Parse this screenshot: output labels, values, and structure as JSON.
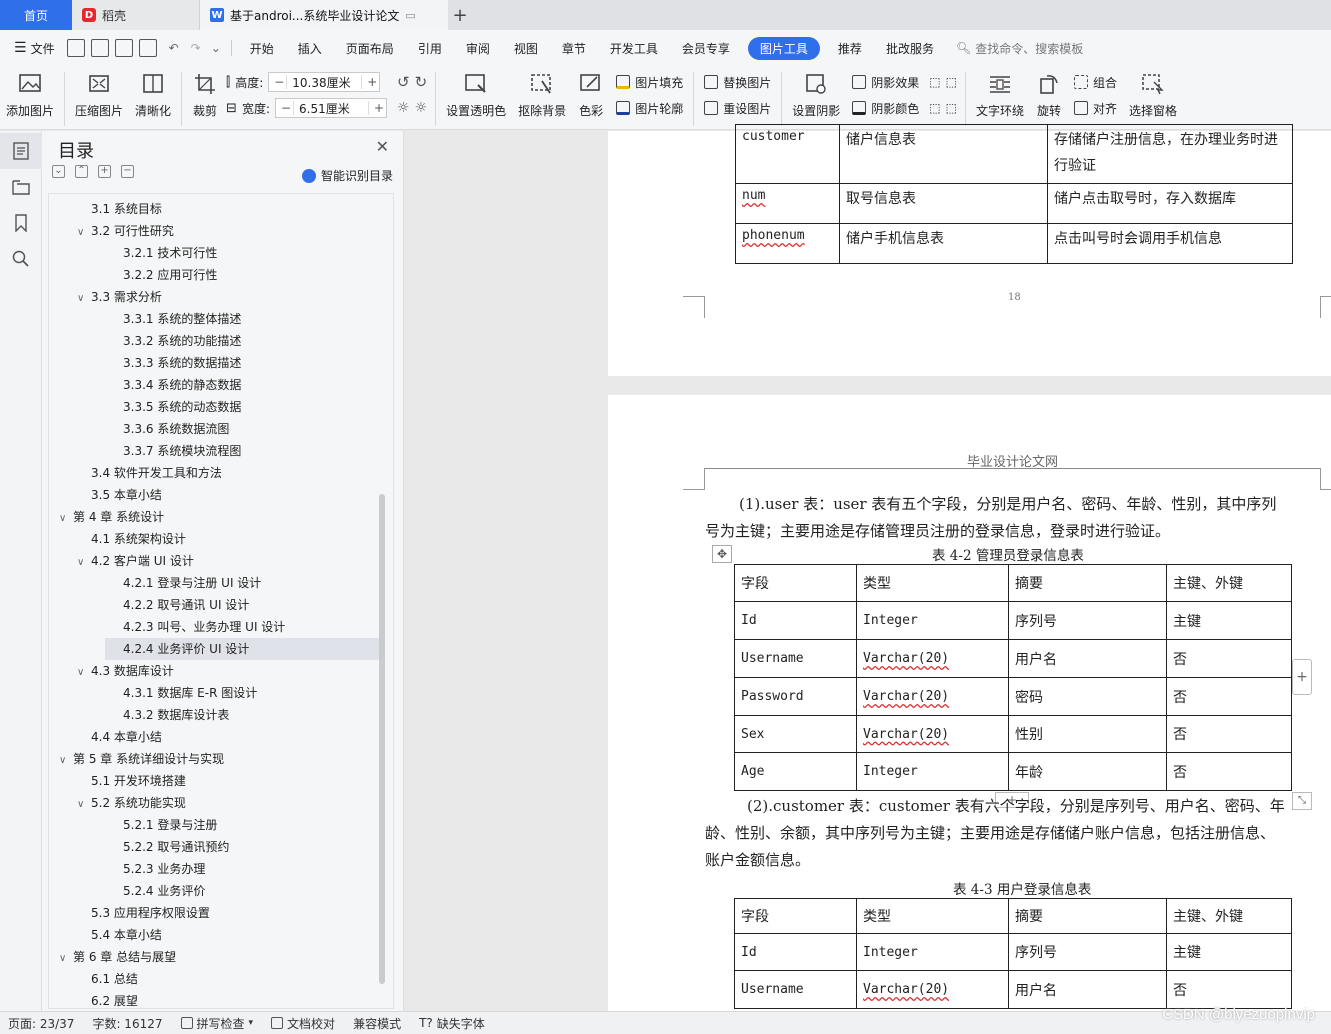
{
  "tabs": {
    "home": "首页",
    "t2": "稻壳",
    "t3": "基于androi...系统毕业设计论文"
  },
  "menu": {
    "file": "文件",
    "items": [
      "开始",
      "插入",
      "页面布局",
      "引用",
      "审阅",
      "视图",
      "章节",
      "开发工具",
      "会员专享",
      "图片工具",
      "推荐",
      "批改服务"
    ],
    "search": "查找命令、搜索模板"
  },
  "ribbon": {
    "add_image": "添加图片",
    "compress": "压缩图片",
    "sharpen": "清晰化",
    "crop": "裁剪",
    "height_label": "高度:",
    "height_value": "10.38厘米",
    "width_label": "宽度:",
    "width_value": "6.51厘米",
    "transparent": "设置透明色",
    "remove_bg": "抠除背景",
    "color": "色彩",
    "fill": "图片填充",
    "outline": "图片轮廓",
    "replace": "替换图片",
    "reset": "重设图片",
    "set_shadow": "设置阴影",
    "shadow_effect": "阴影效果",
    "shadow_color": "阴影颜色",
    "wrap": "文字环绕",
    "rotate": "旋转",
    "group": "组合",
    "align": "对齐",
    "selection_pane": "选择窗格"
  },
  "toc": {
    "title": "目录",
    "smart": "智能识别目录",
    "items": [
      {
        "label": "3.1  系统目标",
        "level": 2,
        "chev": ""
      },
      {
        "label": "3.2  可行性研究",
        "level": 2,
        "chev": "v"
      },
      {
        "label": "3.2.1  技术可行性",
        "level": 3,
        "chev": ""
      },
      {
        "label": "3.2.2  应用可行性",
        "level": 3,
        "chev": ""
      },
      {
        "label": "3.3  需求分析",
        "level": 2,
        "chev": "v"
      },
      {
        "label": "3.3.1  系统的整体描述",
        "level": 3,
        "chev": ""
      },
      {
        "label": "3.3.2  系统的功能描述",
        "level": 3,
        "chev": ""
      },
      {
        "label": "3.3.3 系统的数据描述",
        "level": 3,
        "chev": ""
      },
      {
        "label": "3.3.4  系统的静态数据",
        "level": 3,
        "chev": ""
      },
      {
        "label": "3.3.5  系统的动态数据",
        "level": 3,
        "chev": ""
      },
      {
        "label": "3.3.6  系统数据流图",
        "level": 3,
        "chev": ""
      },
      {
        "label": "3.3.7  系统模块流程图",
        "level": 3,
        "chev": ""
      },
      {
        "label": "3.4  软件开发工具和方法",
        "level": 2,
        "chev": ""
      },
      {
        "label": "3.5  本章小结",
        "level": 2,
        "chev": ""
      },
      {
        "label": "第 4 章  系统设计",
        "level": 1,
        "chev": "v"
      },
      {
        "label": "4.1  系统架构设计",
        "level": 2,
        "chev": ""
      },
      {
        "label": "4.2  客户端  UI  设计",
        "level": 2,
        "chev": "v"
      },
      {
        "label": "4.2.1  登录与注册 UI 设计",
        "level": 3,
        "chev": ""
      },
      {
        "label": "4.2.2 取号通讯 UI 设计",
        "level": 3,
        "chev": ""
      },
      {
        "label": "4.2.3 叫号、业务办理 UI 设计",
        "level": 3,
        "chev": ""
      },
      {
        "label": "4.2.4 业务评价 UI 设计",
        "level": 3,
        "chev": "",
        "selected": true
      },
      {
        "label": "4.3  数据库设计",
        "level": 2,
        "chev": "v"
      },
      {
        "label": "4.3.1 数据库 E-R 图设计",
        "level": 3,
        "chev": ""
      },
      {
        "label": "4.3.2 数据库设计表",
        "level": 3,
        "chev": ""
      },
      {
        "label": "4.4  本章小结",
        "level": 2,
        "chev": ""
      },
      {
        "label": "第 5 章  系统详细设计与实现",
        "level": 1,
        "chev": "v"
      },
      {
        "label": "5.1  开发环境搭建",
        "level": 2,
        "chev": ""
      },
      {
        "label": "5.2  系统功能实现",
        "level": 2,
        "chev": "v"
      },
      {
        "label": "5.2.1  登录与注册",
        "level": 3,
        "chev": ""
      },
      {
        "label": "5.2.2 取号通讯预约",
        "level": 3,
        "chev": ""
      },
      {
        "label": "5.2.3 业务办理",
        "level": 3,
        "chev": ""
      },
      {
        "label": "5.2.4 业务评价",
        "level": 3,
        "chev": ""
      },
      {
        "label": "5.3 应用程序权限设置",
        "level": 2,
        "chev": ""
      },
      {
        "label": "5.4 本章小结",
        "level": 2,
        "chev": ""
      },
      {
        "label": "第 6 章  总结与展望",
        "level": 1,
        "chev": "v"
      },
      {
        "label": "6.1  总结",
        "level": 2,
        "chev": ""
      },
      {
        "label": "6.2  展望",
        "level": 2,
        "chev": ""
      }
    ]
  },
  "page1": {
    "table": [
      [
        "customer",
        "储户信息表",
        "存储储户注册信息，在办理业务时进行验证"
      ],
      [
        "num",
        "取号信息表",
        "储户点击取号时，存入数据库"
      ],
      [
        "phonenum",
        "储户手机信息表",
        "点击叫号时会调用手机信息"
      ]
    ],
    "page_number": "18"
  },
  "page2": {
    "header": "毕业设计论文网",
    "para1_line1": "(1).user 表：user 表有五个字段，分别是用户名、密码、年龄、性别，其中序列",
    "para1_line2": "号为主键；主要用途是存储管理员注册的登录信息，登录时进行验证。",
    "caption1": "表 4-2 管理员登录信息表",
    "table1": [
      [
        "字段",
        "类型",
        "摘要",
        "主键、外键"
      ],
      [
        "Id",
        "Integer",
        "序列号",
        "主键"
      ],
      [
        "Username",
        "Varchar(20)",
        "用户名",
        "否"
      ],
      [
        "Password",
        "Varchar(20)",
        "密码",
        "否"
      ],
      [
        "Sex",
        "Varchar(20)",
        "性别",
        "否"
      ],
      [
        "Age",
        "Integer",
        "年龄",
        "否"
      ]
    ],
    "para2_line1": "(2).customer 表：customer 表有六个字段，分别是序列号、用户名、密码、年",
    "para2_line2": "龄、性别、余额，其中序列号为主键；主要用途是存储储户账户信息，包括注册信息、",
    "para2_line3": "账户金额信息。",
    "caption2": "表 4-3 用户登录信息表",
    "table2": [
      [
        "字段",
        "类型",
        "摘要",
        "主键、外键"
      ],
      [
        "Id",
        "Integer",
        "序列号",
        "主键"
      ],
      [
        "Username",
        "Varchar(20)",
        "用户名",
        "否"
      ]
    ]
  },
  "status": {
    "page": "页面: 23/37",
    "words": "字数: 16127",
    "spell": "拼写检查",
    "proof": "文档校对",
    "compat": "兼容模式",
    "missing_font": "缺失字体"
  },
  "watermark": "CSDN @biyezuopinvip"
}
